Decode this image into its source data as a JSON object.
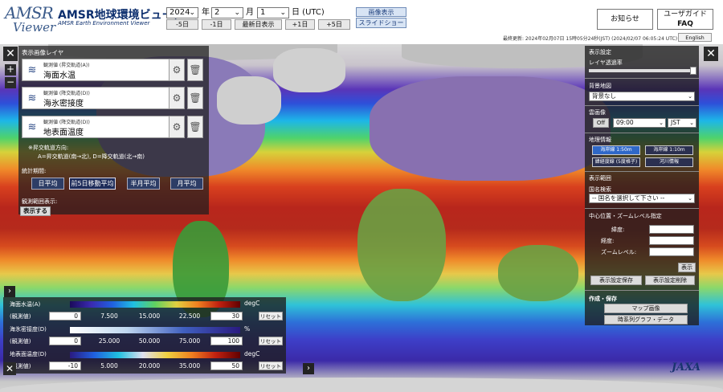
{
  "app": {
    "logo_main": "AMSR",
    "logo_sub": "Viewer",
    "title": "AMSR地球環境ビューア",
    "subtitle": "AMSR Earth Environment Viewer"
  },
  "date": {
    "year": "2024",
    "year_unit": "年",
    "month": "2",
    "month_unit": "月",
    "day": "1",
    "day_unit": "日 (UTC)",
    "nav": [
      "-5日",
      "-1日",
      "最新日表示",
      "+1日",
      "+5日"
    ]
  },
  "display_buttons": {
    "image": "画像表示",
    "slideshow": "スライドショー"
  },
  "header_links": {
    "notice": "お知らせ",
    "guide": "ユーザガイド",
    "faq": "FAQ"
  },
  "last_updated": "最終更新: 2024年02月07日 15時05分24秒(JST) (2024/02/07 06:05:24 UTC)",
  "language_button": "English",
  "layer_panel": {
    "title": "表示画像レイヤ",
    "layers": [
      {
        "sub": "観測値 (昇交軌道(A))",
        "name": "海面水温"
      },
      {
        "sub": "観測値 (降交軌道(D))",
        "name": "海氷密接度"
      },
      {
        "sub": "観測値 (降交軌道(D))",
        "name": "地表面温度"
      }
    ],
    "orbit_note_1": "※昇交軌道方向:",
    "orbit_note_2": "A=昇交軌道(南→北), D=降交軌道(北→南)",
    "period_label": "統計期間:",
    "periods": [
      "日平均",
      "前5日移動平均",
      "半月平均",
      "月平均"
    ],
    "range_label": "観測範囲表示:",
    "show_button": "表示する"
  },
  "right_panel": {
    "title": "表示設定",
    "layer_opacity": "レイヤ透過率",
    "background_label": "背景地図",
    "background_value": "背景なし",
    "cloud_label": "雲画像",
    "cloud_off": "Off",
    "cloud_time": "09:00",
    "cloud_tz": "JST",
    "geo_label": "地理情報",
    "geo_buttons": [
      "海岸線 1:50m",
      "海岸線 1:10m",
      "緯経度線 (5度格子)",
      "河川情報"
    ],
    "range_label": "表示範囲",
    "country_search": "国名検索",
    "country_placeholder": "-- 国名を選択して下さい --",
    "center_zoom": "中心位置・ズームレベル指定",
    "lat": "緯度:",
    "lon": "経度:",
    "zoom": "ズームレベル:",
    "show": "表示",
    "save": "表示設定保存",
    "delete": "表示設定削除",
    "create_label": "作成・保存",
    "map_image": "マップ画像",
    "timeseries": "時系列グラフ・データ"
  },
  "legend": {
    "rows": [
      {
        "title": "海面水温(A)",
        "unit": "degC",
        "sub": "(観測値)",
        "min": "0",
        "ticks": [
          "7.500",
          "15.000",
          "22.500"
        ],
        "max": "30"
      },
      {
        "title": "海氷密接度(D)",
        "unit": "%",
        "sub": "(観測値)",
        "min": "0",
        "ticks": [
          "25.000",
          "50.000",
          "75.000"
        ],
        "max": "100"
      },
      {
        "title": "地表面温度(D)",
        "unit": "degC",
        "sub": "(観測値)",
        "min": "-10",
        "ticks": [
          "5.000",
          "20.000",
          "35.000"
        ],
        "max": "50"
      }
    ],
    "reset": "リセット"
  },
  "credit": "JAXA"
}
